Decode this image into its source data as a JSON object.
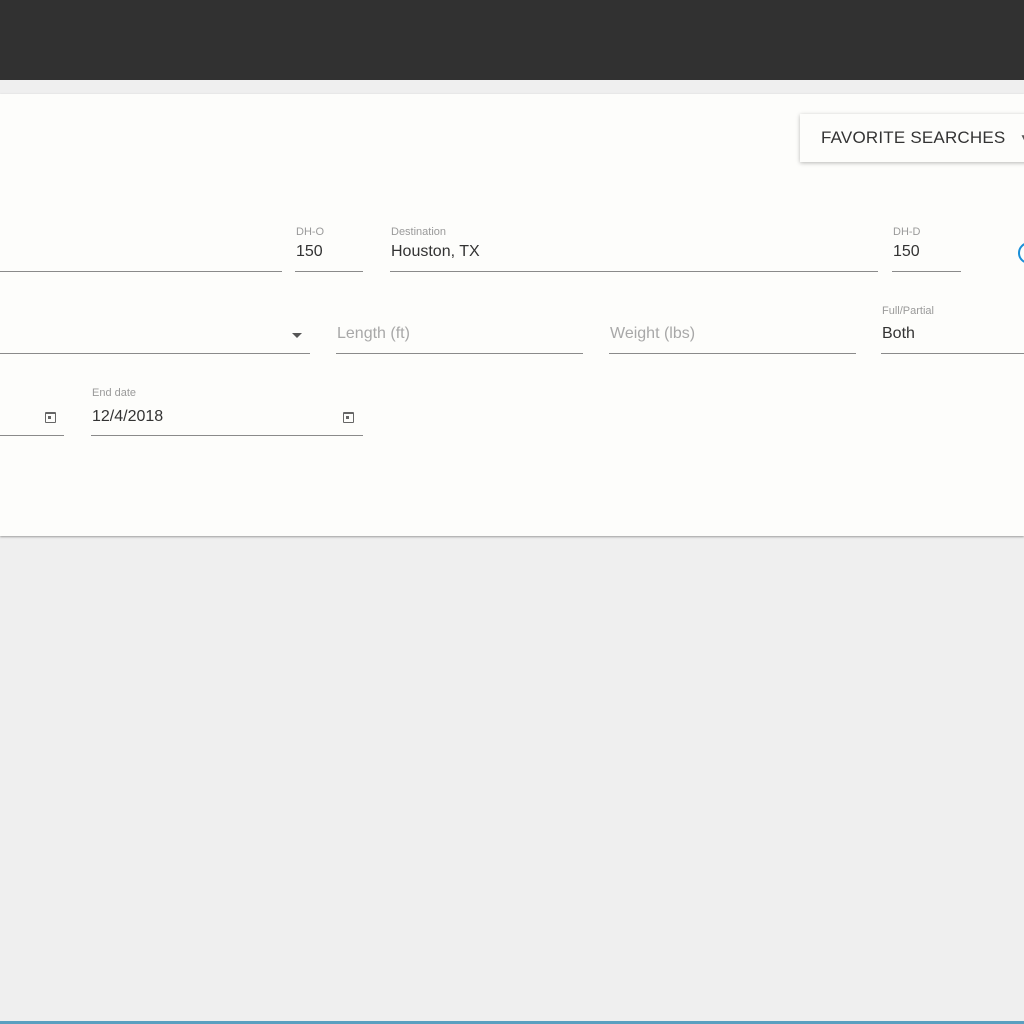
{
  "header": {
    "favorite_searches_label": "FAVORITE SEARCHES",
    "favorite_searches_icon": "chevron-down-icon"
  },
  "search_form": {
    "dh_o": {
      "label": "DH-O",
      "value": "150"
    },
    "destination": {
      "label": "Destination",
      "value": "Houston, TX"
    },
    "dh_d": {
      "label": "DH-D",
      "value": "150"
    },
    "length": {
      "placeholder": "Length (ft)"
    },
    "weight": {
      "placeholder": "Weight (lbs)"
    },
    "full_partial": {
      "label": "Full/Partial",
      "value": "Both"
    },
    "end_date": {
      "label": "End date",
      "value": "12/4/2018"
    }
  },
  "colors": {
    "topbar": "#313131",
    "card": "#fdfdfb",
    "page_background": "#efefef",
    "accent": "#1a8fd8"
  }
}
